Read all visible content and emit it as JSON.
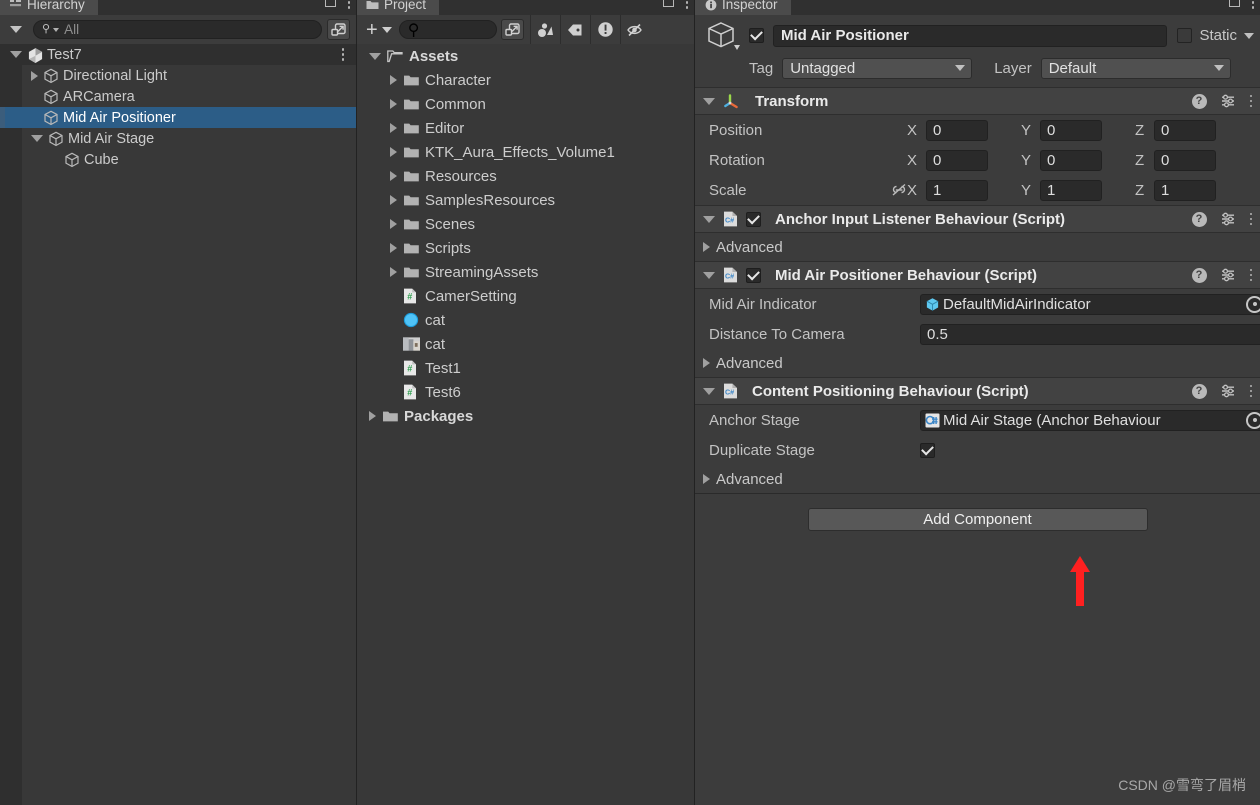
{
  "window": {
    "background": "#383838",
    "accent_selection": "#2c5d87",
    "annotation_arrow_color": "#ff2020"
  },
  "hierarchy": {
    "tab_label": "Hierarchy",
    "tab_icon": "hierarchy-icon",
    "search": {
      "value": "",
      "placeholder": "All"
    },
    "rows": [
      {
        "label": "Test7",
        "icon": "unity-scene-icon",
        "indent": 0,
        "twisty": "open",
        "root": true,
        "selected": false,
        "kebab": true
      },
      {
        "label": "Directional Light",
        "icon": "gameobject-cube-icon",
        "indent": 1,
        "twisty": "closed",
        "root": false,
        "selected": false,
        "kebab": false
      },
      {
        "label": "ARCamera",
        "icon": "gameobject-cube-icon",
        "indent": 1,
        "twisty": "none",
        "root": false,
        "selected": false,
        "kebab": false
      },
      {
        "label": "Mid Air Positioner",
        "icon": "gameobject-cube-icon",
        "indent": 1,
        "twisty": "none",
        "root": false,
        "selected": true,
        "kebab": false
      },
      {
        "label": "Mid Air Stage",
        "icon": "gameobject-cube-icon",
        "indent": 1,
        "twisty": "open",
        "root": false,
        "selected": false,
        "kebab": false
      },
      {
        "label": "Cube",
        "icon": "gameobject-cube-icon",
        "indent": 2,
        "twisty": "none",
        "root": false,
        "selected": false,
        "kebab": false
      }
    ]
  },
  "project": {
    "tab_label": "Project",
    "tab_icon": "folder-icon",
    "toolbar": {
      "add_label": "+",
      "search": {
        "value": "",
        "placeholder": ""
      },
      "buttons": [
        {
          "name": "favorites-icon"
        },
        {
          "name": "label-tag-icon"
        },
        {
          "name": "warning-icon"
        },
        {
          "name": "hidden-packages-icon"
        }
      ]
    },
    "rows": [
      {
        "label": "Assets",
        "icon": "folder-open-icon",
        "indent": 0,
        "twisty": "open",
        "bold": true
      },
      {
        "label": "Character",
        "icon": "folder-icon",
        "indent": 1,
        "twisty": "closed",
        "bold": false
      },
      {
        "label": "Common",
        "icon": "folder-icon",
        "indent": 1,
        "twisty": "closed",
        "bold": false
      },
      {
        "label": "Editor",
        "icon": "folder-icon",
        "indent": 1,
        "twisty": "closed",
        "bold": false
      },
      {
        "label": "KTK_Aura_Effects_Volume1",
        "icon": "folder-icon",
        "indent": 1,
        "twisty": "closed",
        "bold": false
      },
      {
        "label": "Resources",
        "icon": "folder-icon",
        "indent": 1,
        "twisty": "closed",
        "bold": false
      },
      {
        "label": "SamplesResources",
        "icon": "folder-icon",
        "indent": 1,
        "twisty": "closed",
        "bold": false
      },
      {
        "label": "Scenes",
        "icon": "folder-icon",
        "indent": 1,
        "twisty": "closed",
        "bold": false
      },
      {
        "label": "Scripts",
        "icon": "folder-icon",
        "indent": 1,
        "twisty": "closed",
        "bold": false
      },
      {
        "label": "StreamingAssets",
        "icon": "folder-icon",
        "indent": 1,
        "twisty": "closed",
        "bold": false
      },
      {
        "label": "CamerSetting",
        "icon": "csharp-script-icon",
        "indent": 1,
        "twisty": "none",
        "bold": false
      },
      {
        "label": "cat",
        "icon": "material-sphere-icon",
        "indent": 1,
        "twisty": "none",
        "bold": false
      },
      {
        "label": "cat",
        "icon": "texture-image-icon",
        "indent": 1,
        "twisty": "none",
        "bold": false
      },
      {
        "label": "Test1",
        "icon": "csharp-script-icon",
        "indent": 1,
        "twisty": "none",
        "bold": false
      },
      {
        "label": "Test6",
        "icon": "csharp-script-icon",
        "indent": 1,
        "twisty": "none",
        "bold": false
      },
      {
        "label": "Packages",
        "icon": "folder-icon",
        "indent": 0,
        "twisty": "closed",
        "bold": true
      }
    ]
  },
  "inspector": {
    "tab_label": "Inspector",
    "tab_icon": "info-icon",
    "gameobject": {
      "enabled": true,
      "name": "Mid Air Positioner",
      "static_label": "Static",
      "static_checked": false,
      "tag_label": "Tag",
      "tag_value": "Untagged",
      "layer_label": "Layer",
      "layer_value": "Default"
    },
    "components": [
      {
        "title": "Transform",
        "icon": "transform-axis-icon",
        "has_checkbox": false,
        "expanded": true,
        "rows": [
          {
            "kind": "vector3",
            "label": "Position",
            "axes": [
              "X",
              "Y",
              "Z"
            ],
            "values": [
              "0",
              "0",
              "0"
            ],
            "link_icon": false
          },
          {
            "kind": "vector3",
            "label": "Rotation",
            "axes": [
              "X",
              "Y",
              "Z"
            ],
            "values": [
              "0",
              "0",
              "0"
            ],
            "link_icon": false
          },
          {
            "kind": "vector3",
            "label": "Scale",
            "axes": [
              "X",
              "Y",
              "Z"
            ],
            "values": [
              "1",
              "1",
              "1"
            ],
            "link_icon": true
          }
        ]
      },
      {
        "title": "Anchor Input Listener Behaviour (Script)",
        "icon": "csharp-script-icon",
        "has_checkbox": true,
        "checked": true,
        "expanded": true,
        "rows": [
          {
            "kind": "foldout",
            "label": "Advanced"
          }
        ]
      },
      {
        "title": "Mid Air Positioner Behaviour (Script)",
        "icon": "csharp-script-icon",
        "has_checkbox": true,
        "checked": true,
        "expanded": true,
        "rows": [
          {
            "kind": "object",
            "label": "Mid Air Indicator",
            "value": "DefaultMidAirIndicator",
            "value_icon": "prefab-cube-icon"
          },
          {
            "kind": "text",
            "label": "Distance To Camera",
            "value": "0.5"
          },
          {
            "kind": "foldout",
            "label": "Advanced"
          }
        ]
      },
      {
        "title": "Content Positioning Behaviour (Script)",
        "icon": "csharp-script-icon",
        "has_checkbox": false,
        "expanded": true,
        "rows": [
          {
            "kind": "object",
            "label": "Anchor Stage",
            "value": "Mid Air Stage (Anchor Behaviour",
            "value_icon": "script-asset-icon"
          },
          {
            "kind": "checkbox",
            "label": "Duplicate Stage",
            "checked": true
          },
          {
            "kind": "foldout",
            "label": "Advanced"
          }
        ]
      }
    ],
    "add_component_label": "Add Component"
  },
  "watermark": "CSDN @雪弯了眉梢"
}
